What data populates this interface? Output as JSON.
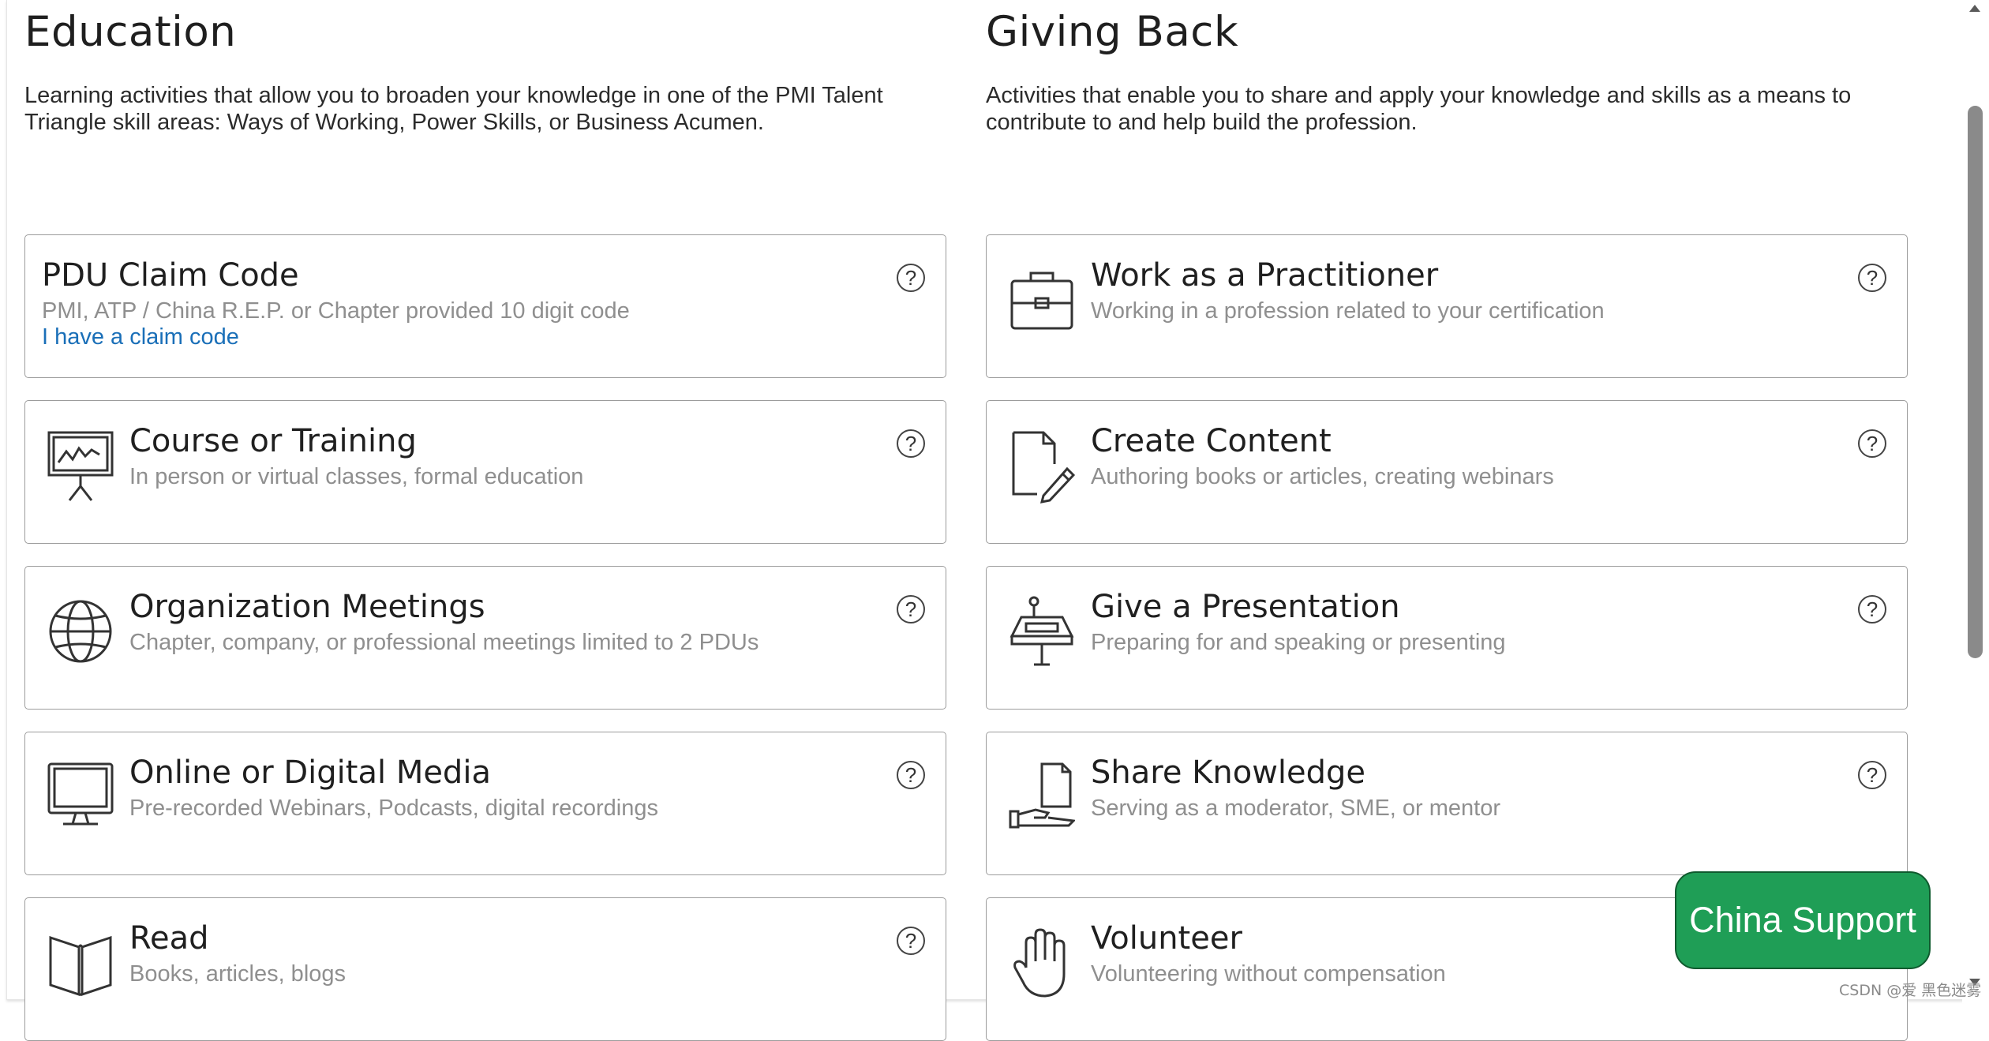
{
  "education": {
    "title": "Education",
    "description": "Learning activities that allow you to broaden your knowledge in one of the PMI Talent Triangle skill areas: Ways of Working, Power Skills, or Business Acumen.",
    "cards": [
      {
        "title": "PDU Claim Code",
        "subtitle": "PMI, ATP / China R.E.P. or Chapter provided 10 digit code",
        "link": "I have a claim code"
      },
      {
        "title": "Course or Training",
        "subtitle": "In person or virtual classes, formal education",
        "icon": "presentation-board-icon"
      },
      {
        "title": "Organization Meetings",
        "subtitle": "Chapter, company, or professional meetings limited to 2 PDUs",
        "icon": "globe-icon"
      },
      {
        "title": "Online or Digital Media",
        "subtitle": "Pre-recorded Webinars, Podcasts, digital recordings",
        "icon": "monitor-icon"
      },
      {
        "title": "Read",
        "subtitle": "Books, articles, blogs",
        "icon": "open-book-icon"
      }
    ]
  },
  "giving_back": {
    "title": "Giving Back",
    "description": "Activities that enable you to share and apply your knowledge and skills as a means to contribute to and help build the profession.",
    "cards": [
      {
        "title": "Work as a Practitioner",
        "subtitle": "Working in a profession related to your certification",
        "icon": "briefcase-icon"
      },
      {
        "title": "Create Content",
        "subtitle": "Authoring books or articles, creating webinars",
        "icon": "document-pencil-icon"
      },
      {
        "title": "Give a Presentation",
        "subtitle": "Preparing for and speaking or presenting",
        "icon": "podium-microphone-icon"
      },
      {
        "title": "Share Knowledge",
        "subtitle": "Serving as a moderator, SME, or mentor",
        "icon": "hand-document-icon"
      },
      {
        "title": "Volunteer",
        "subtitle": "Volunteering without compensation",
        "icon": "raised-hand-icon"
      }
    ]
  },
  "help_symbol": "?",
  "china_support": "China Support",
  "watermark": "CSDN @爱 黑色迷雾",
  "colors": {
    "accent_green": "#1f9e56",
    "link_blue": "#1a6fb8",
    "muted_text": "#8f8f8f",
    "card_border": "#9c9c9c"
  }
}
